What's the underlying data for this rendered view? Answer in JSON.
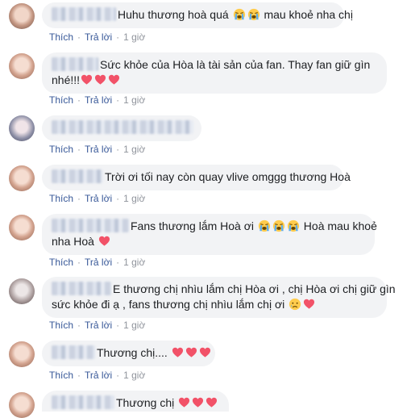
{
  "actions": {
    "like": "Thích",
    "reply": "Trả lời",
    "sep": "·",
    "time": "1 giờ"
  },
  "colors": {
    "bubble": "#f2f3f5",
    "link": "#385898",
    "muted": "#90949c",
    "heart": "#f25268"
  },
  "icons": {
    "heart": "red-heart-emoji",
    "cry": "loudly-crying-face-emoji",
    "sad": "crying-face-emoji"
  },
  "comments": [
    {
      "text": "Huhu thương hoà quá",
      "text2": "mau khoẻ nha chị"
    },
    {
      "line1": "Sức khỏe của Hòa là tài sản của fan. Thay fan giữ gìn",
      "line2": "nhé!!!"
    },
    {},
    {
      "text": "Trời ơi tối nay còn quay vlive omggg thương Hoà"
    },
    {
      "line1a": "Fans thương lắm Hoà ơi",
      "line1b": "Hoà mau khoẻ",
      "line2": "nha Hoà"
    },
    {
      "line1": "E thương chị nhìu lắm chị Hòa ơi , chị Hòa ơi chị giữ gìn",
      "line2": "sức khỏe đi ạ , fans thương chị nhìu lắm chị ơi"
    },
    {
      "text": "Thương chị...."
    },
    {
      "text": "Thương chị"
    }
  ]
}
